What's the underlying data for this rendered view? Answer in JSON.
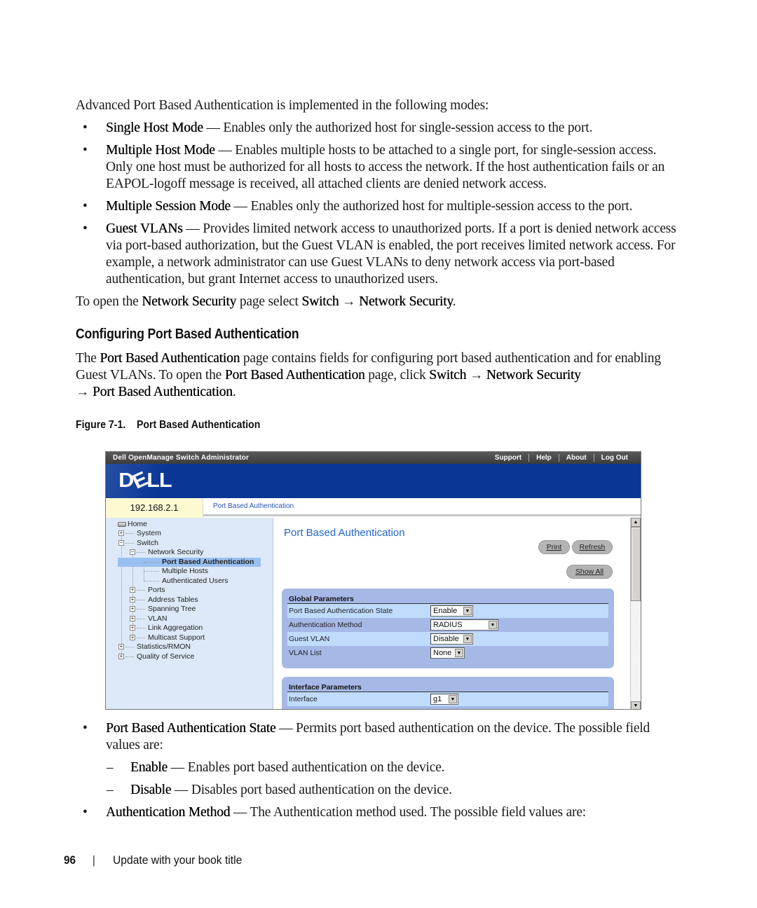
{
  "intro": "Advanced Port Based Authentication is implemented in the following modes:",
  "modes": [
    {
      "term": "Single Host Mode",
      "desc": " — Enables only the authorized host for single-session access to the port."
    },
    {
      "term": "Multiple Host Mode",
      "desc": " — Enables multiple hosts to be attached to a single port, for single-session access. Only one host must be authorized for all hosts to access the network. If the host authentication fails or an EAPOL-logoff message is received, all attached clients are denied network access."
    },
    {
      "term": "Multiple Session Mode",
      "desc": " — Enables only the authorized host for multiple-session access to the port."
    },
    {
      "term": "Guest VLANs",
      "desc": " — Provides limited network access to unauthorized ports. If a port is denied network access via port-based authorization, but the Guest VLAN is enabled, the port receives limited network access. For example, a network administrator can use Guest VLANs to deny network access via port-based authentication, but grant Internet access to unauthorized users."
    }
  ],
  "open_network_security": {
    "pre": "To open the ",
    "page": "Network Security",
    "mid": " page select ",
    "path1": "Switch",
    "arrow": " → ",
    "path2": "Network Security",
    "end": "."
  },
  "section": {
    "heading": "Configuring Port Based Authentication",
    "p_pre": "The ",
    "p_term": "Port Based Authentication",
    "p_mid": " page contains fields for configuring port based authentication and for enabling Guest VLANs. To open the ",
    "p_term2": "Port Based Authentication",
    "p_mid2": " page, click ",
    "p_path1": "Switch",
    "p_arrow": " → ",
    "p_path2": "Network Security",
    "p_arrow2": "→ ",
    "p_path3": "Port Based Authentication",
    "p_end": "."
  },
  "figure": {
    "number": "Figure 7-1.",
    "title": "Port Based Authentication"
  },
  "app": {
    "title": "Dell OpenManage Switch Administrator",
    "links": [
      "Support",
      "Help",
      "About",
      "Log Out"
    ],
    "logo": {
      "d": "D",
      "e": "E",
      "ll": "LL"
    },
    "ip": "192.168.2.1",
    "breadcrumb": "Port Based Authentication",
    "tree": {
      "home": "Home",
      "system": "System",
      "switch": "Switch",
      "network_security": "Network Security",
      "port_based_auth": "Port Based Authentication",
      "multiple_hosts": "Multiple Hosts",
      "authenticated_users": "Authenticated Users",
      "ports": "Ports",
      "address_tables": "Address Tables",
      "spanning_tree": "Spanning Tree",
      "vlan": "VLAN",
      "link_aggregation": "Link Aggregation",
      "multicast_support": "Multicast Support",
      "statistics_rmon": "Statistics/RMON",
      "qos": "Quality of Service"
    },
    "page_heading": "Port Based Authentication",
    "buttons": {
      "print": "Print",
      "refresh": "Refresh",
      "show_all": "Show All"
    },
    "global_params": {
      "title": "Global Parameters",
      "rows": [
        {
          "label": "Port Based Authentication State",
          "value": "Enable"
        },
        {
          "label": "Authentication Method",
          "value": "RADIUS"
        },
        {
          "label": "Guest VLAN",
          "value": "Disable"
        },
        {
          "label": "VLAN List",
          "value": "None"
        }
      ]
    },
    "interface_params": {
      "title": "Interface Parameters",
      "rows": [
        {
          "label": "Interface",
          "value": "g1"
        }
      ]
    },
    "icons": {
      "plus": "+",
      "minus": "−",
      "arrow_down": "▼",
      "arrow_up": "▲"
    }
  },
  "fields": {
    "state": {
      "term": "Port Based Authentication State",
      "desc": " — Permits port based authentication on the device. The possible field values are:"
    },
    "enable": {
      "term": "Enable",
      "desc": " — Enables port based authentication on the device."
    },
    "disable": {
      "term": "Disable",
      "desc": " — Disables port based authentication on the device."
    },
    "method": {
      "term": "Authentication Method",
      "desc": " — The Authentication method used. The possible field values are:"
    }
  },
  "glyphs": {
    "bullet": "•",
    "dash": "–"
  },
  "footer": {
    "page_number": "96",
    "separator": "|",
    "book_title": "Update with your book title"
  }
}
